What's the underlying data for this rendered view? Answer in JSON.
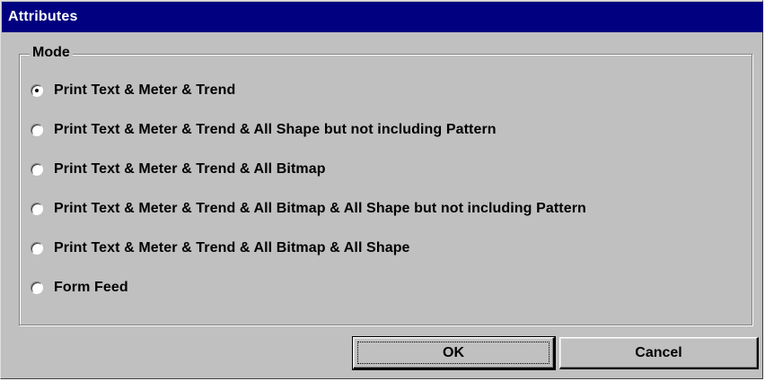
{
  "window": {
    "title": "Attributes"
  },
  "mode_group": {
    "legend": "Mode",
    "options": [
      {
        "label": "Print Text & Meter & Trend",
        "checked": true
      },
      {
        "label": "Print Text & Meter & Trend & All Shape but not including Pattern",
        "checked": false
      },
      {
        "label": "Print Text & Meter & Trend & All Bitmap",
        "checked": false
      },
      {
        "label": "Print Text & Meter & Trend & All Bitmap &  All Shape but not including Pattern",
        "checked": false
      },
      {
        "label": "Print Text & Meter & Trend & All Bitmap &  All Shape",
        "checked": false
      },
      {
        "label": "Form Feed",
        "checked": false
      }
    ]
  },
  "buttons": {
    "ok_label": "OK",
    "cancel_label": "Cancel"
  },
  "colors": {
    "titlebar": "#000080",
    "face": "#c0c0c0"
  }
}
